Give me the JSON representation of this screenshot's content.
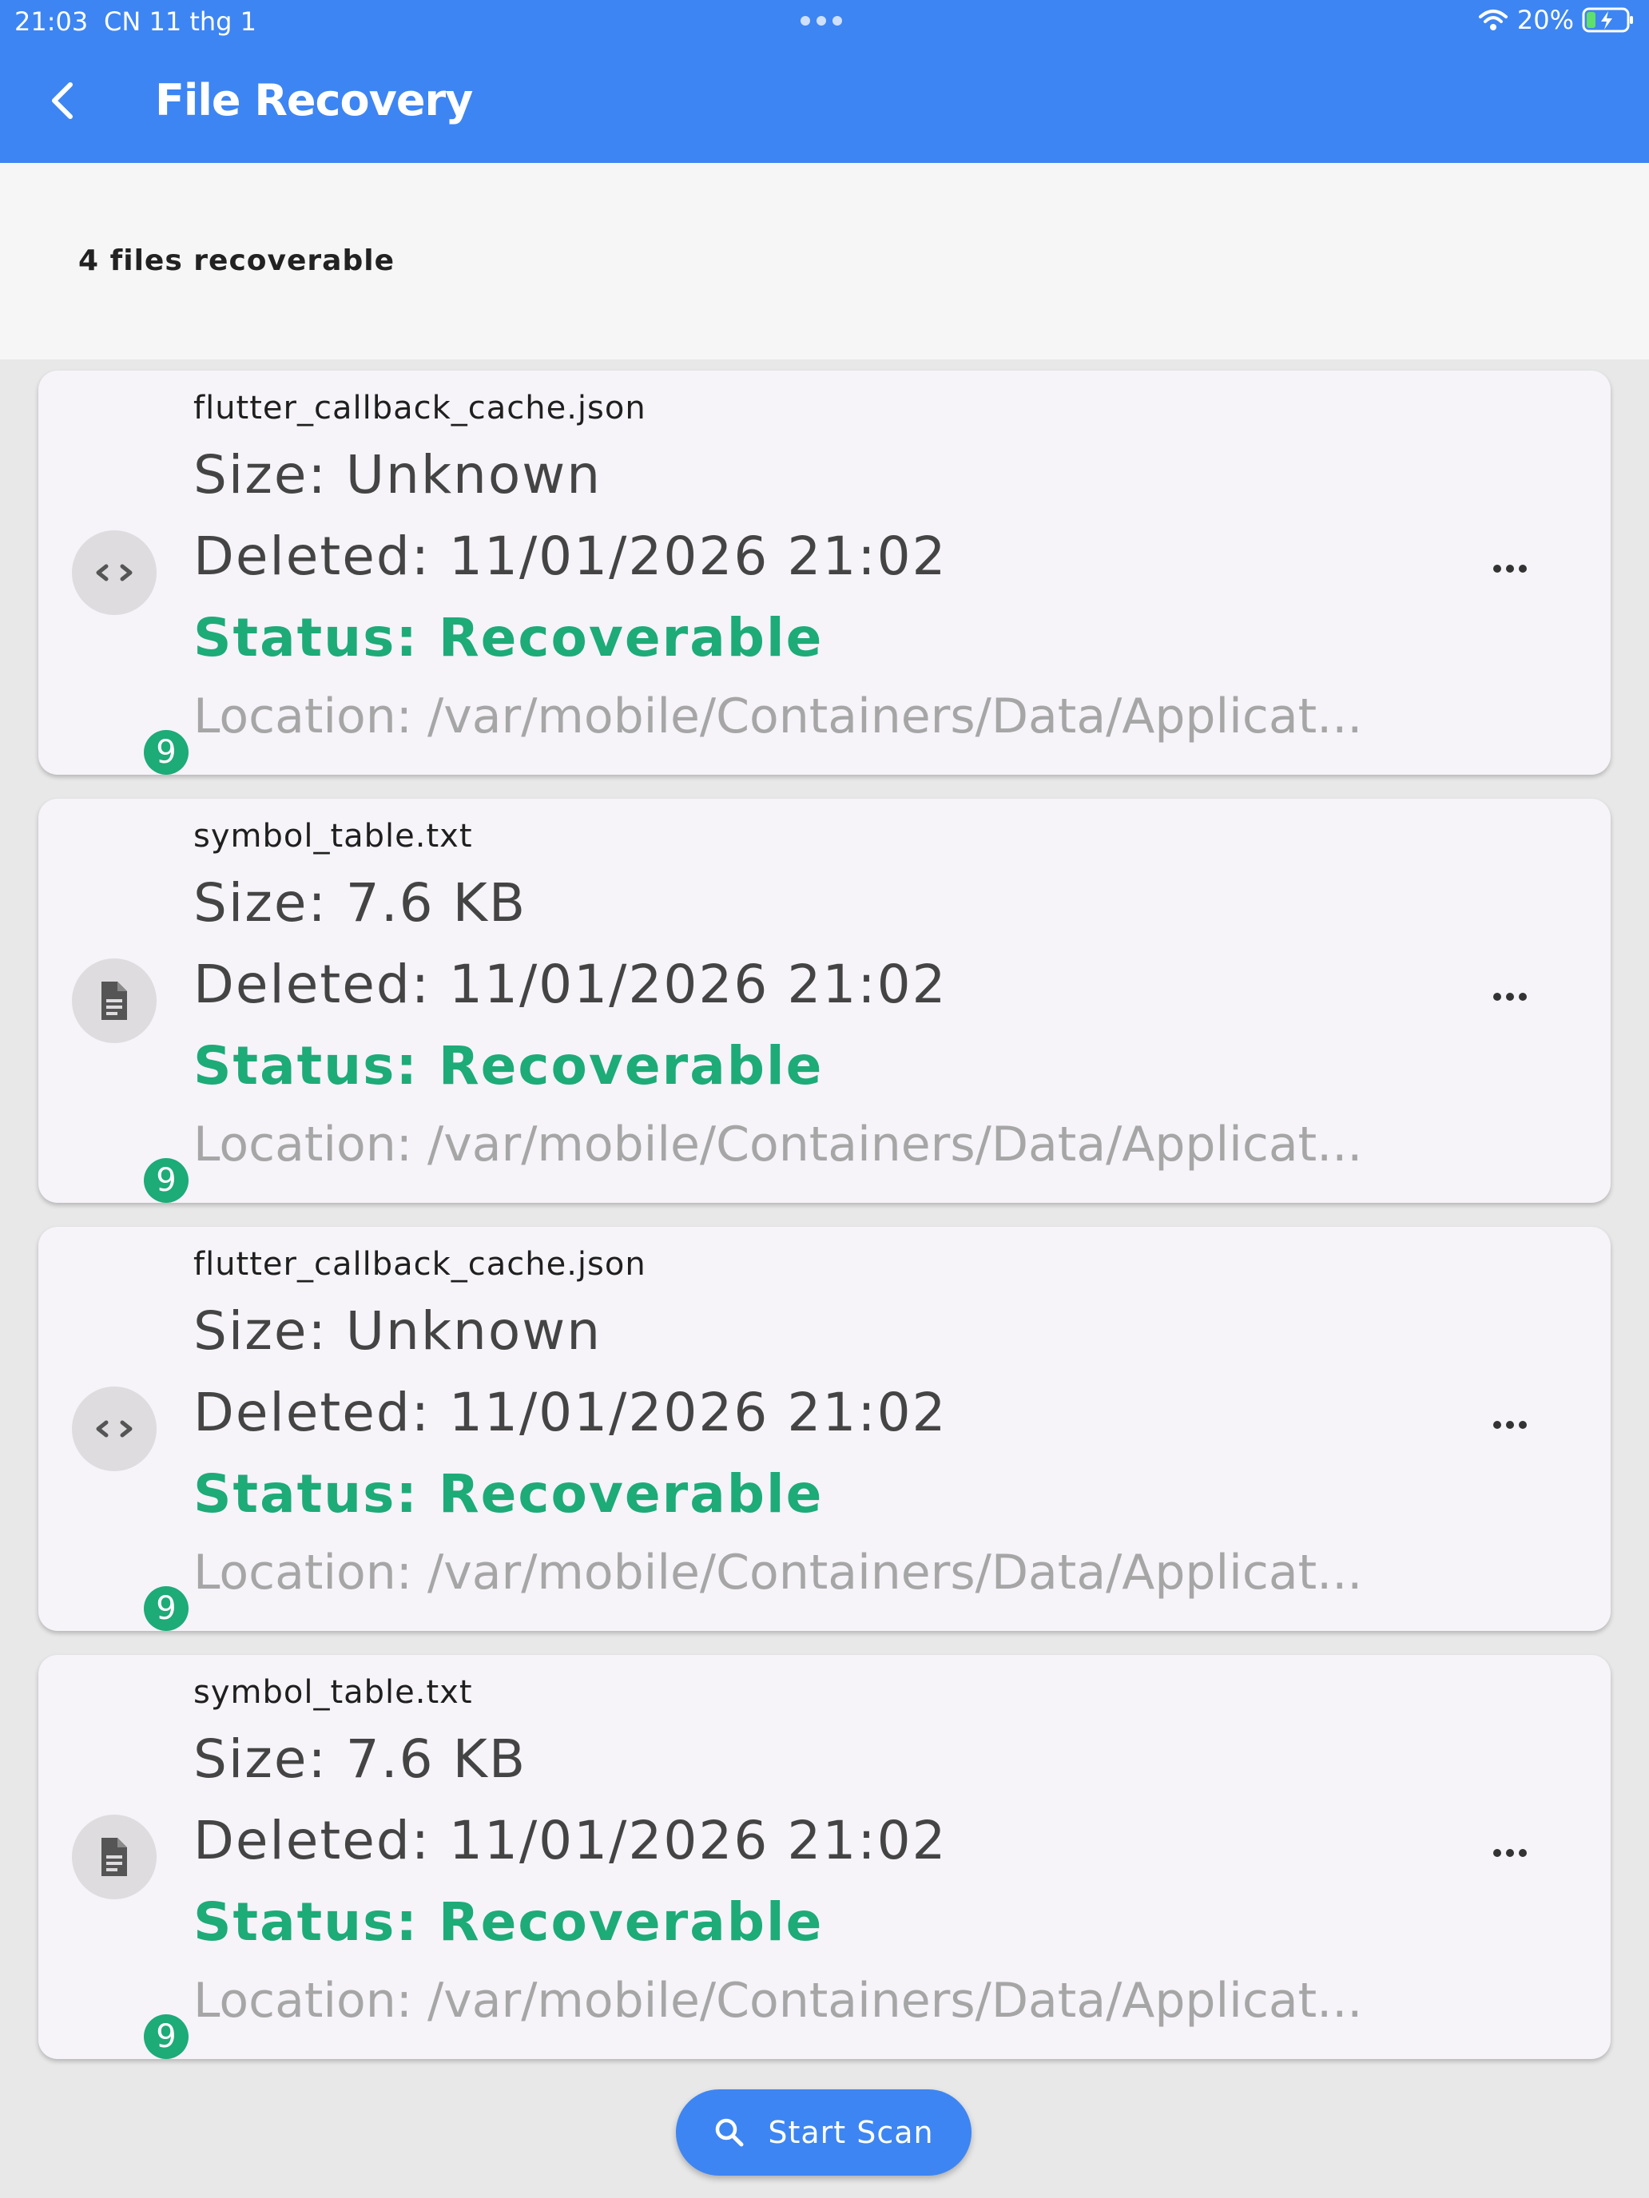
{
  "status_bar": {
    "time": "21:03",
    "date": "CN 11 thg 1",
    "battery": "20%",
    "wifi_icon": "wifi-icon",
    "battery_icon": "battery-charging-icon"
  },
  "app_bar": {
    "title": "File Recovery",
    "back_icon": "chevron-left-icon"
  },
  "summary": {
    "count_text": "4 files recoverable"
  },
  "colors": {
    "primary": "#3d85f2",
    "status_green": "#1dab78",
    "card_bg": "#f6f3f9",
    "location_gray": "#a6a6a6"
  },
  "files": [
    {
      "name": "flutter_callback_cache.json",
      "size": "Size: Unknown",
      "deleted": "Deleted: 11/01/2026 21:02",
      "status": "Status: Recoverable",
      "location": "Location: /var/mobile/Containers/Data/Applicat...",
      "icon": "code-file-icon",
      "badge": "9"
    },
    {
      "name": "symbol_table.txt",
      "size": "Size: 7.6 KB",
      "deleted": "Deleted: 11/01/2026 21:02",
      "status": "Status: Recoverable",
      "location": "Location: /var/mobile/Containers/Data/Applicat...",
      "icon": "text-file-icon",
      "badge": "9"
    },
    {
      "name": "flutter_callback_cache.json",
      "size": "Size: Unknown",
      "deleted": "Deleted: 11/01/2026 21:02",
      "status": "Status: Recoverable",
      "location": "Location: /var/mobile/Containers/Data/Applicat...",
      "icon": "code-file-icon",
      "badge": "9"
    },
    {
      "name": "symbol_table.txt",
      "size": "Size: 7.6 KB",
      "deleted": "Deleted: 11/01/2026 21:02",
      "status": "Status: Recoverable",
      "location": "Location: /var/mobile/Containers/Data/Applicat...",
      "icon": "text-file-icon",
      "badge": "9"
    }
  ],
  "scan_button": {
    "label": "Start Scan",
    "icon": "search-icon"
  }
}
